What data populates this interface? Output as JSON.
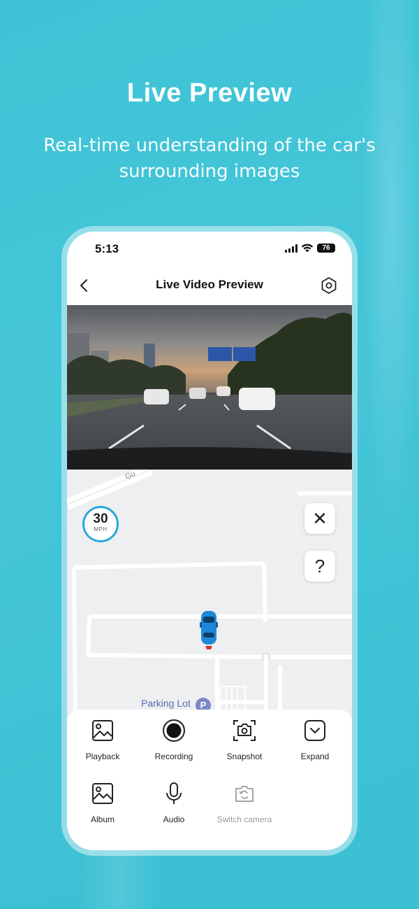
{
  "hero": {
    "title": "Live Preview",
    "subtitle": "Real-time understanding of the car's surrounding images"
  },
  "status_bar": {
    "time": "5:13",
    "battery": "76"
  },
  "nav": {
    "title": "Live Video Preview",
    "back_icon": "chevron-left-icon",
    "settings_icon": "settings-hexagon-icon"
  },
  "map": {
    "speed_value": "30",
    "speed_unit": "MPH",
    "road_label": "Gu",
    "parking_label": "Parking Lot",
    "parking_badge": "P",
    "close_icon": "close-icon",
    "help_icon": "help-icon",
    "close_glyph": "✕",
    "help_glyph": "?"
  },
  "actions": [
    {
      "label": "Playback",
      "icon": "image-icon",
      "enabled": true
    },
    {
      "label": "Recording",
      "icon": "record-icon",
      "enabled": true
    },
    {
      "label": "Snapshot",
      "icon": "camera-icon",
      "enabled": true
    },
    {
      "label": "Expand",
      "icon": "expand-down-icon",
      "enabled": true
    },
    {
      "label": "Album",
      "icon": "album-icon",
      "enabled": true
    },
    {
      "label": "Audio",
      "icon": "microphone-icon",
      "enabled": true
    },
    {
      "label": "Switch camera",
      "icon": "switch-camera-icon",
      "enabled": false
    }
  ],
  "colors": {
    "background": "#42c4d7",
    "speed_ring": "#2aa7d8",
    "car": "#1e88d8",
    "parking": "#5a6bb0"
  }
}
